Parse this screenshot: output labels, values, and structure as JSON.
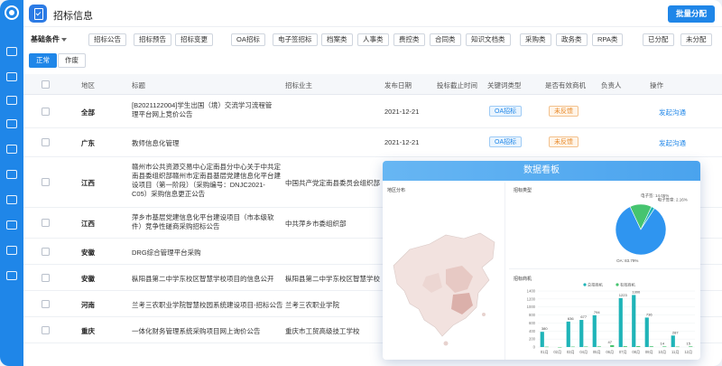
{
  "header": {
    "title": "招标信息",
    "batch_button": "批量分配"
  },
  "filters": {
    "basic_conditions": "基础条件",
    "chips": [
      "招标公告",
      "招标预告",
      "招标变更",
      "OA招标",
      "电子签招标",
      "档案类",
      "人事类",
      "费控类",
      "合同类",
      "知识文档类",
      "采购类",
      "政务类",
      "RPA类",
      "已分配",
      "未分配"
    ]
  },
  "status_tabs": [
    "正常",
    "作废"
  ],
  "table": {
    "columns": [
      "地区",
      "标题",
      "招标业主",
      "发布日期",
      "投标截止时间",
      "关键词类型",
      "是否有效商机",
      "负责人",
      "操作"
    ],
    "rows": [
      {
        "region": "全部",
        "title": "[B2021122004]学生出国（境）交流学习流程管理平台网上竞价公告",
        "owner": "",
        "date": "2021-12-21",
        "keyword": "OA招标",
        "valid": "未反馈",
        "action": "发起沟通"
      },
      {
        "region": "广东",
        "title": "教师信息化管理",
        "owner": "",
        "date": "2021-12-21",
        "keyword": "OA招标",
        "valid": "未反馈",
        "action": "发起沟通"
      },
      {
        "region": "江西",
        "title": "赣州市公共资源交易中心定南县分中心关于中共定南县委组织部赣州市定南县基层党建信息化平台建设项目（第一阶段）（采购编号：DNJC2021-C05）采购信息更正公告",
        "owner": "中国共产党定南县委员会组织部",
        "date": "",
        "keyword": "",
        "valid": "",
        "action": ""
      },
      {
        "region": "江西",
        "title": "萍乡市基层党建信息化平台建设项目（市本级软件）竞争性磋商采购招标公告",
        "owner": "中共萍乡市委组织部",
        "date": "",
        "keyword": "",
        "valid": "",
        "action": ""
      },
      {
        "region": "安徽",
        "title": "DRG综合管理平台采购",
        "owner": "",
        "date": "",
        "keyword": "",
        "valid": "",
        "action": ""
      },
      {
        "region": "安徽",
        "title": "枞阳县第二中学东校区智慧学校项目的信息公开",
        "owner": "枞阳县第二中学东校区智慧学校",
        "date": "",
        "keyword": "",
        "valid": "",
        "action": ""
      },
      {
        "region": "河南",
        "title": "兰考三农职业学院智慧校园系统建设项目-招标公告",
        "owner": "兰考三农职业学院",
        "date": "",
        "keyword": "",
        "valid": "",
        "action": ""
      },
      {
        "region": "重庆",
        "title": "一体化财务管理系统采购项目网上询价公告",
        "owner": "重庆市工贸高级技工学校",
        "date": "",
        "keyword": "",
        "valid": "",
        "action": ""
      }
    ]
  },
  "dashboard": {
    "title": "数据看板",
    "map_title": "地区分布",
    "pie_title": "招标类型",
    "bar_title": "招标商机",
    "colors": {
      "blue": "#2f95f0",
      "green": "#46c46f",
      "teal": "#1fb4b8"
    }
  },
  "chart_data": [
    {
      "type": "pie",
      "title": "招标类型",
      "labels": [
        "电子签: 14.05%",
        "电子签章: 2.16%",
        "OA: 83.79%"
      ],
      "values": [
        14.05,
        2.16,
        83.79
      ],
      "legend": []
    },
    {
      "type": "bar",
      "title": "招标商机",
      "categories": [
        "01月",
        "02月",
        "03月",
        "04月",
        "05月",
        "06月",
        "07月",
        "08月",
        "09月",
        "10月",
        "11月",
        "12月"
      ],
      "series": [
        {
          "name": "总招商机",
          "values": [
            380,
            0,
            636,
            677,
            794,
            0,
            1223,
            1300,
            736,
            0,
            287,
            0
          ]
        },
        {
          "name": "有效商机",
          "values": [
            8,
            0,
            10,
            12,
            15,
            47,
            20,
            22,
            18,
            14,
            10,
            15
          ]
        }
      ],
      "y_ticks": [
        0,
        200,
        400,
        600,
        800,
        1000,
        1200,
        1400
      ],
      "data_labels": [
        "380",
        "",
        "636",
        "677",
        "794",
        "47",
        "1223",
        "1300",
        "736",
        "14",
        "287",
        "15"
      ]
    }
  ]
}
